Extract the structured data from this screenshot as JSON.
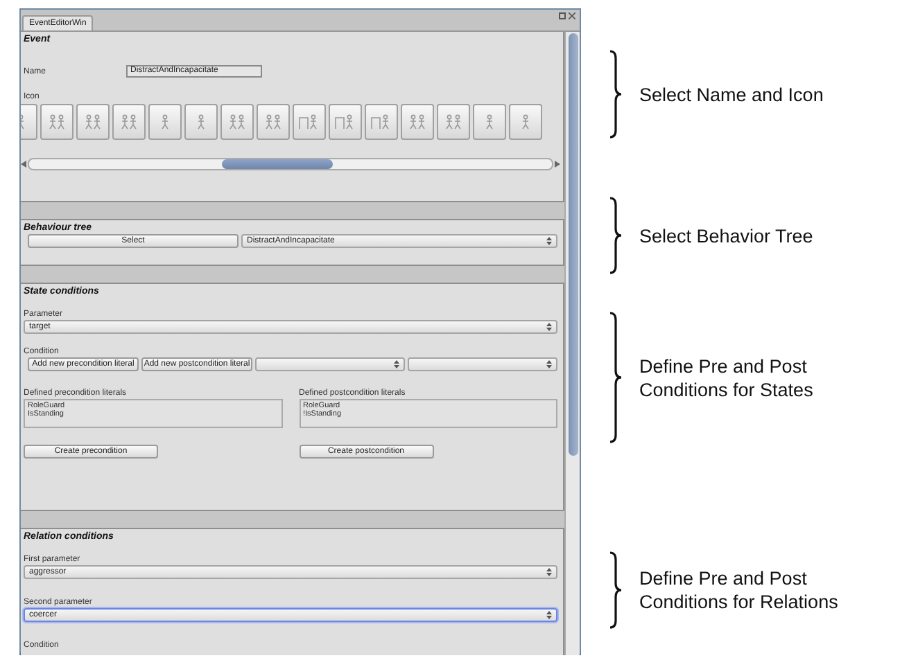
{
  "window": {
    "tab": {
      "label": "EventEditorWin",
      "selected": true
    }
  },
  "event": {
    "title": "Event",
    "name_label": "Name",
    "name_value": "DistractAndIncapacitate",
    "icon_label": "Icon",
    "icon_tiles": [
      {
        "kind": "figure"
      },
      {
        "kind": "pair"
      },
      {
        "kind": "pair"
      },
      {
        "kind": "pair"
      },
      {
        "kind": "figure"
      },
      {
        "kind": "figure"
      },
      {
        "kind": "pair"
      },
      {
        "kind": "pair"
      },
      {
        "kind": "door"
      },
      {
        "kind": "door"
      },
      {
        "kind": "door"
      },
      {
        "kind": "pair"
      },
      {
        "kind": "pair"
      },
      {
        "kind": "figure"
      },
      {
        "kind": "figure"
      }
    ]
  },
  "behaviour_tree": {
    "title": "Behaviour tree",
    "select_button": "Select",
    "tree": "DistractAndIncapacitate"
  },
  "state_conditions": {
    "title": "State conditions",
    "parameter_label": "Parameter",
    "parameter": "target",
    "condition_label": "Condition",
    "buttons": [
      "Add new precondition literal",
      "Add new postcondition literal"
    ],
    "condition_dropdowns": [
      {
        "kind": "popup"
      },
      {
        "kind": "popup"
      }
    ],
    "literals": [
      {
        "label": "Defined precondition literals",
        "lines": [
          "RoleGuard",
          "IsStanding"
        ],
        "button": "Create precondition"
      },
      {
        "label": "Defined postcondition literals",
        "lines": [
          "RoleGuard",
          "!IsStanding"
        ],
        "button": "Create postcondition"
      }
    ]
  },
  "relation_conditions": {
    "title": "Relation conditions",
    "parameters": [
      {
        "label": "First parameter",
        "value": "aggressor",
        "focused": false
      },
      {
        "label": "Second parameter",
        "value": "coercer",
        "focused": true
      }
    ],
    "condition_label": "Condition"
  },
  "annotations": [
    {
      "lines": [
        "Select Name and Icon"
      ]
    },
    {
      "lines": [
        "Select Behavior Tree"
      ]
    },
    {
      "lines": [
        "Define Pre and Post",
        "Conditions for States"
      ]
    },
    {
      "lines": [
        "Define Pre and Post",
        "Conditions for Relations"
      ]
    }
  ]
}
